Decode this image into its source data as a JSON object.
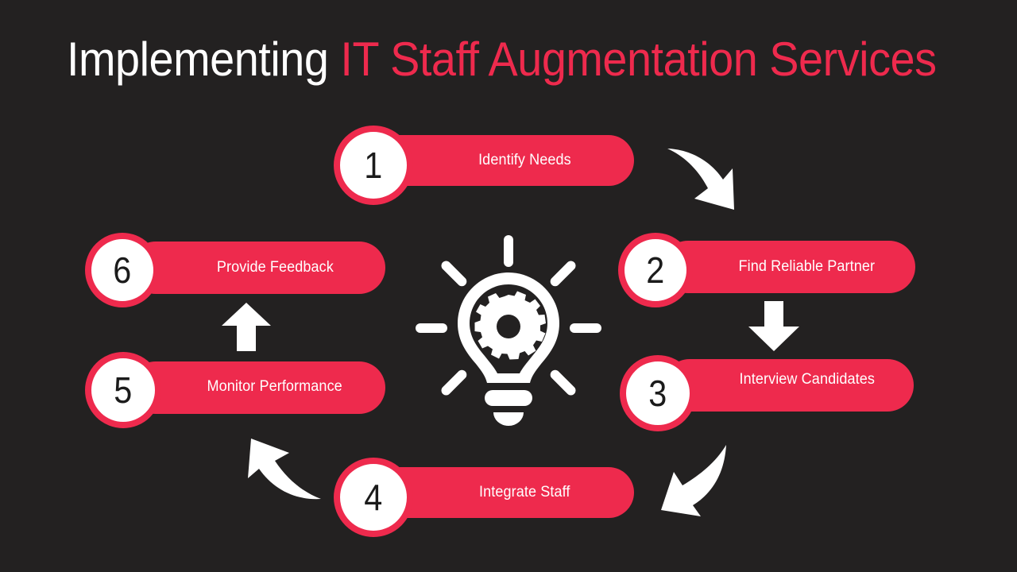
{
  "slide": {
    "background_color": "#232121",
    "accent_color": "#EE2A4D",
    "text_color": "#FFFFFF"
  },
  "title": {
    "part_white": "Implementing",
    "part_red": "IT Staff Augmentation Services",
    "full": "Implementing IT Staff Augmentation Services"
  },
  "center_icon": {
    "name": "lightbulb-gear-icon",
    "color": "#FFFFFF"
  },
  "steps": [
    {
      "number": "1",
      "label": "Identify Needs"
    },
    {
      "number": "2",
      "label": "Find Reliable Partner"
    },
    {
      "number": "3",
      "label": "Interview Candidates"
    },
    {
      "number": "4",
      "label": "Integrate Staff"
    },
    {
      "number": "5",
      "label": "Monitor Performance"
    },
    {
      "number": "6",
      "label": "Provide Feedback"
    }
  ],
  "connectors": [
    {
      "name": "arrow-step1-to-step2",
      "direction": "curved-down-right"
    },
    {
      "name": "arrow-step2-to-step3",
      "direction": "straight-down"
    },
    {
      "name": "arrow-step3-to-step4",
      "direction": "curved-down-left"
    },
    {
      "name": "arrow-step4-to-step5",
      "direction": "curved-up-left"
    },
    {
      "name": "arrow-step5-to-step6",
      "direction": "straight-up"
    }
  ]
}
